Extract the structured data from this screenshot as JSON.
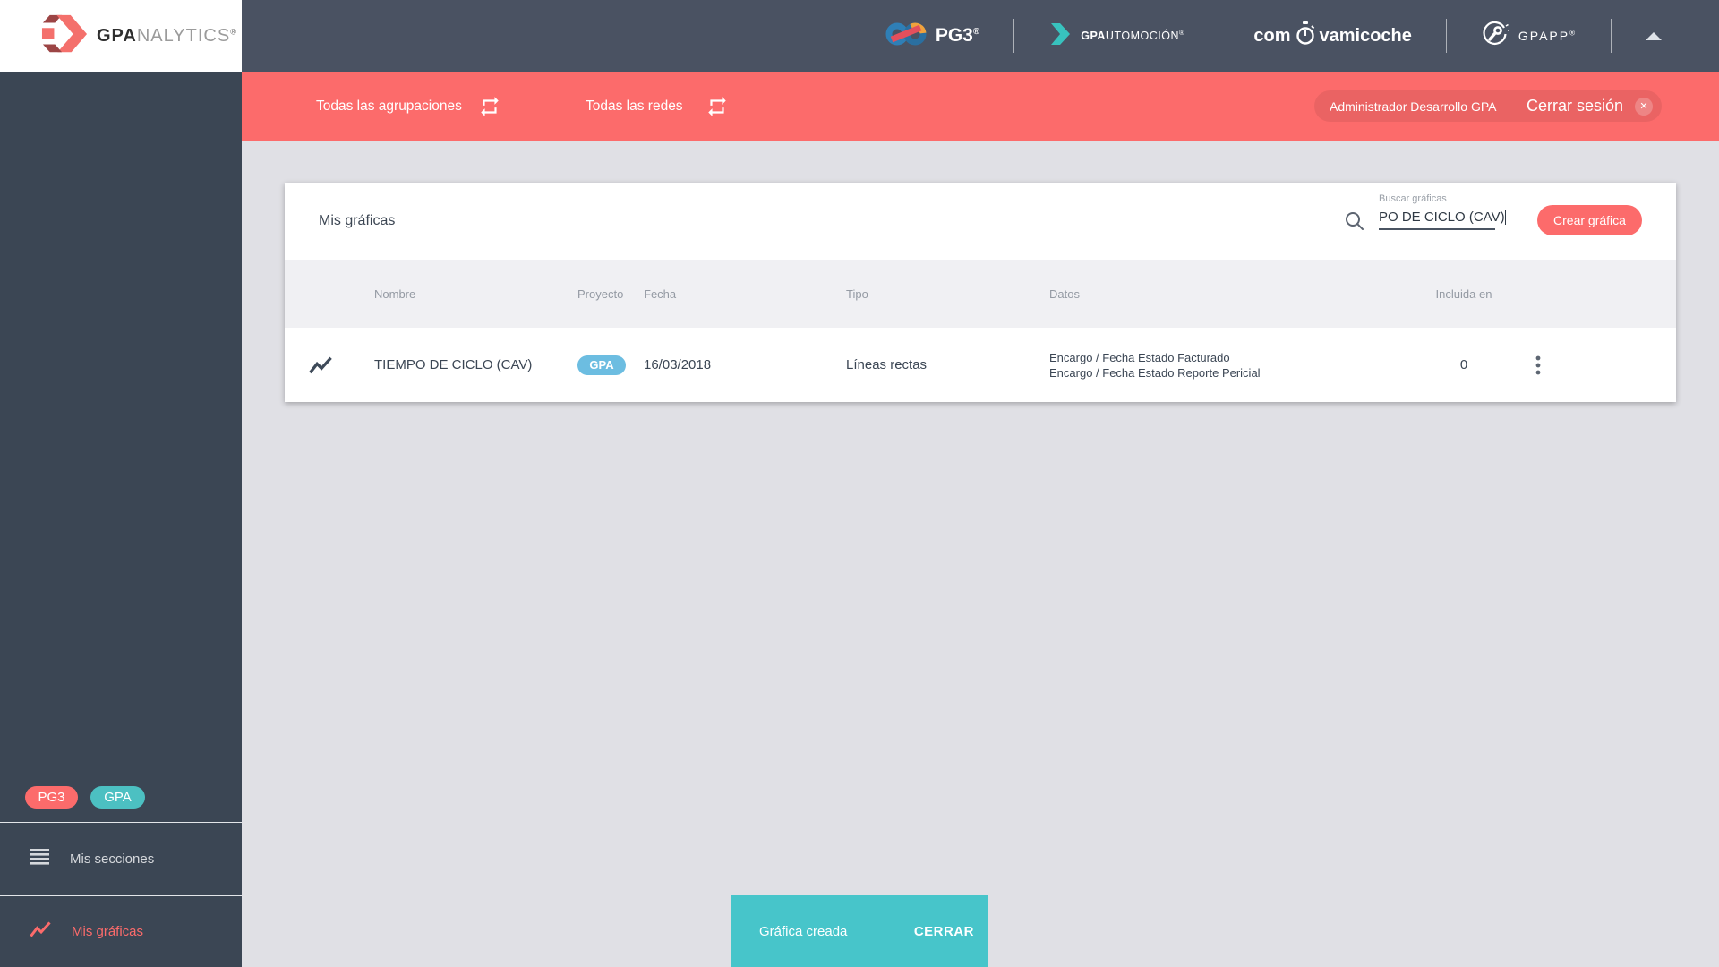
{
  "brand": {
    "bold": "GPA",
    "light": "NALYTICS",
    "reg": "®"
  },
  "top_nav": {
    "pg3": {
      "label": "PG3",
      "reg": "®"
    },
    "gpautomocion": {
      "bold": "GPA",
      "rest": "UTOMOCIÓN",
      "reg": "®"
    },
    "compravamicoche": {
      "pre": "com",
      "post": "vamicoche"
    },
    "gpapp": {
      "label": "GPAPP",
      "reg": "®"
    }
  },
  "filter_bar": {
    "agrupaciones": "Todas las agrupaciones",
    "redes": "Todas las redes",
    "user": "Administrador Desarrollo GPA",
    "logout": "Cerrar sesión",
    "close_glyph": "✕"
  },
  "sidebar": {
    "badges": [
      {
        "label": "PG3"
      },
      {
        "label": "GPA"
      }
    ],
    "items": [
      {
        "label": "Mis secciones"
      },
      {
        "label": "Mis gráficas"
      }
    ]
  },
  "card": {
    "title": "Mis gráficas",
    "search_label": "Buscar gráficas",
    "search_value": "PO DE CICLO (CAV)",
    "create_button": "Crear gráfica",
    "table": {
      "headers": [
        "Nombre",
        "Proyecto",
        "Fecha",
        "Tipo",
        "Datos",
        "Incluida en"
      ],
      "row": {
        "name": "TIEMPO DE CICLO (CAV)",
        "project_badge": "GPA",
        "date": "16/03/2018",
        "type": "Líneas rectas",
        "data_line1": "Encargo / Fecha Estado Facturado",
        "data_line2": "Encargo / Fecha Estado Reporte Pericial",
        "included": "0"
      }
    }
  },
  "toast": {
    "message": "Gráfica creada",
    "action": "CERRAR"
  },
  "colors": {
    "accent_red": "#FC6B6B",
    "toast_teal": "#47C5CA",
    "badge_blue": "#6CBDE1",
    "badge_teal": "#4CC0C2",
    "header_slate": "#4A5262",
    "sidebar_slate": "#3B4654"
  }
}
